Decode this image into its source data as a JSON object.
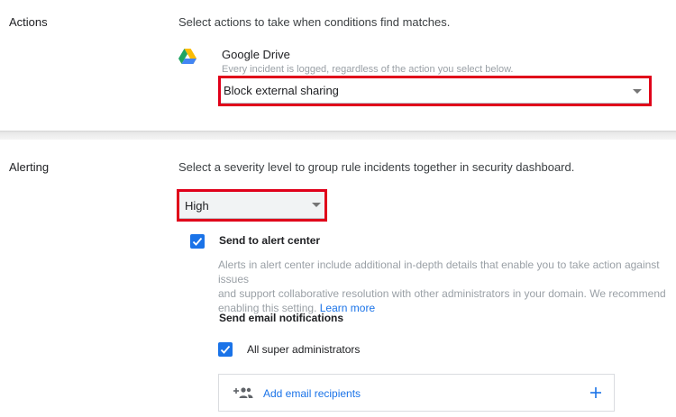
{
  "actions": {
    "label": "Actions",
    "description": "Select actions to take when conditions find matches.",
    "service": {
      "icon": "google-drive-icon",
      "name": "Google Drive",
      "hint": "Every incident is logged, regardless of the action you select below."
    },
    "action_select": {
      "value": "Block external sharing"
    }
  },
  "alerting": {
    "label": "Alerting",
    "description": "Select a severity level to group rule incidents together in security dashboard.",
    "severity_select": {
      "value": "High"
    },
    "send_to_alert_center": {
      "checked": true,
      "label": "Send to alert center",
      "description_lines": [
        "Alerts in alert center include additional in-depth details that enable you to take action against issues",
        "and support collaborative resolution with other administrators in your domain. We recommend"
      ],
      "description_last": "enabling this setting.",
      "learn_more": "Learn more"
    },
    "email_notifications": {
      "heading": "Send email notifications",
      "super_admins": {
        "checked": true,
        "label": "All super administrators"
      },
      "add_recipients": {
        "icon": "add-group-icon",
        "label": "Add email recipients",
        "add_icon": "plus-icon"
      }
    }
  },
  "colors": {
    "accent": "#1a73e8",
    "highlight": "#e0001a"
  }
}
